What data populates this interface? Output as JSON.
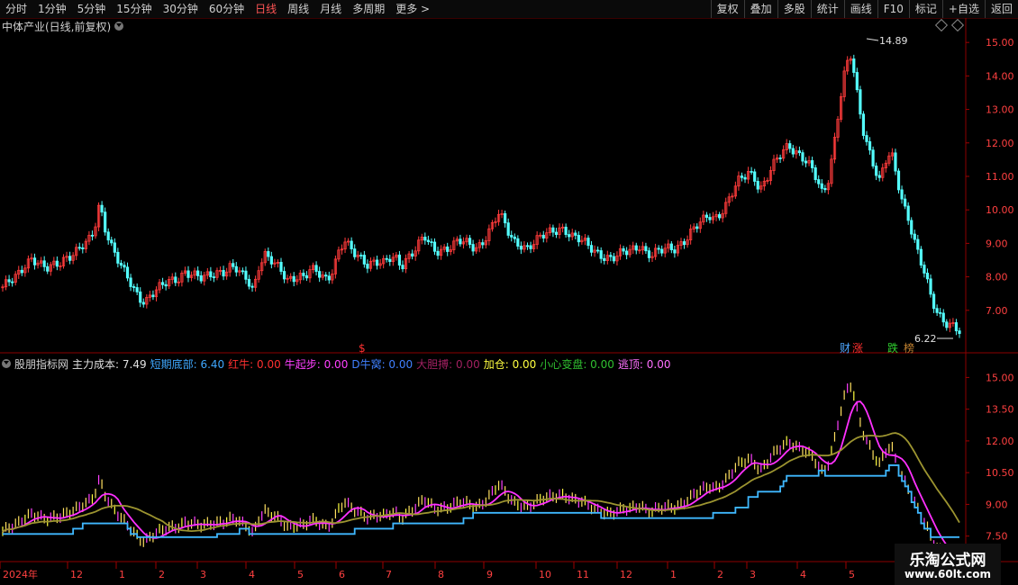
{
  "toolbar": {
    "periods": [
      "分时",
      "1分钟",
      "5分钟",
      "15分钟",
      "30分钟",
      "60分钟",
      "日线",
      "周线",
      "月线",
      "多周期",
      "更多 >"
    ],
    "active_period": "日线",
    "right_buttons": [
      "复权",
      "叠加",
      "多股",
      "统计",
      "画线",
      "F10",
      "标记",
      "+自选",
      "返回"
    ]
  },
  "main_title": "中体产业(日线,前复权)",
  "markers": {
    "high_label": "14.89",
    "low_label": "6.22",
    "dollar": "$",
    "badge_cai": "财",
    "badge_zhang": "涨",
    "badge_die": "跌",
    "badge_bang": "榜"
  },
  "indicator": {
    "name": "股朋指标网",
    "items": [
      {
        "label": "主力成本:",
        "value": "7.49",
        "color": "#e0e0e0"
      },
      {
        "label": "短期底部:",
        "value": "6.40",
        "color": "#3fa8ff"
      },
      {
        "label": "红牛:",
        "value": "0.00",
        "color": "#ff3030"
      },
      {
        "label": "牛起步:",
        "value": "0.00",
        "color": "#ff40ff"
      },
      {
        "label": "D牛窝:",
        "value": "0.00",
        "color": "#4080ff"
      },
      {
        "label": "大胆搏:",
        "value": "0.00",
        "color": "#a02060"
      },
      {
        "label": "加仓:",
        "value": "0.00",
        "color": "#ffff40"
      },
      {
        "label": "小心变盘:",
        "value": "0.00",
        "color": "#30c030"
      },
      {
        "label": "逃顶:",
        "value": "0.00",
        "color": "#ff70ff"
      }
    ]
  },
  "axis": {
    "main_ticks": [
      "15.00",
      "14.00",
      "13.00",
      "12.00",
      "11.00",
      "10.00",
      "9.00",
      "8.00",
      "7.00"
    ],
    "sub_ticks": [
      "15.00",
      "13.50",
      "12.00",
      "10.50",
      "9.00",
      "7.50"
    ],
    "x_labels": [
      "2024年",
      "12",
      "1",
      "2",
      "3",
      "4",
      "5",
      "6",
      "7",
      "8",
      "9",
      "10",
      "11",
      "12",
      "1",
      "2",
      "3",
      "4",
      "5"
    ]
  },
  "watermark": {
    "name": "乐淘公式网",
    "url": "www.60lt.com"
  },
  "chart_data": {
    "type": "candlestick",
    "main": {
      "ylim": [
        6.0,
        15.3
      ],
      "closes": [
        7.7,
        7.8,
        7.9,
        8.1,
        8.4,
        8.6,
        8.5,
        8.3,
        8.2,
        8.3,
        8.4,
        8.6,
        8.7,
        8.8,
        8.9,
        9.0,
        9.3,
        10.2,
        9.5,
        9.0,
        8.6,
        8.2,
        7.9,
        7.6,
        7.4,
        7.3,
        7.5,
        7.6,
        7.7,
        7.8,
        7.9,
        8.0,
        8.2,
        8.1,
        8.0,
        7.9,
        8.0,
        8.1,
        8.2,
        8.2,
        8.3,
        8.2,
        8.0,
        7.9,
        7.6,
        8.4,
        8.7,
        8.5,
        8.3,
        8.1,
        7.9,
        8.0,
        8.1,
        8.0,
        8.2,
        8.1,
        8.0,
        7.9,
        8.3,
        8.8,
        9.1,
        8.8,
        8.6,
        8.5,
        8.4,
        8.5,
        8.5,
        8.4,
        8.5,
        8.5,
        8.3,
        8.6,
        8.8,
        9.0,
        9.2,
        8.9,
        8.7,
        8.8,
        8.9,
        9.0,
        9.1,
        9.0,
        8.9,
        8.8,
        9.0,
        9.3,
        9.6,
        9.9,
        9.6,
        9.2,
        9.0,
        9.0,
        8.9,
        9.0,
        9.1,
        9.2,
        9.3,
        9.4,
        9.5,
        9.4,
        9.2,
        9.1,
        9.0,
        8.9,
        8.8,
        8.7,
        8.6,
        8.5,
        8.6,
        8.7,
        8.8,
        8.9,
        9.0,
        8.7,
        8.6,
        8.7,
        8.8,
        8.9,
        8.9,
        9.0,
        9.1,
        9.3,
        9.5,
        9.7,
        9.9,
        9.8,
        9.9,
        10.1,
        10.4,
        10.8,
        11.0,
        11.2,
        11.0,
        10.6,
        10.8,
        11.2,
        11.5,
        11.8,
        12.0,
        11.8,
        11.6,
        11.4,
        11.2,
        10.9,
        10.5,
        11.0,
        12.0,
        13.2,
        14.2,
        14.6,
        13.5,
        12.5,
        11.9,
        11.3,
        10.8,
        11.4,
        11.7,
        11.0,
        10.3,
        9.8,
        9.1,
        8.5,
        8.0,
        7.4,
        7.0,
        6.8,
        6.6,
        6.5,
        6.3
      ]
    },
    "sub": {
      "ylim": [
        7.4,
        15.4
      ],
      "series": [
        {
          "name": "主力成本",
          "color": "#e0e0e0"
        },
        {
          "name": "短期底部",
          "color": "#3fa8ff"
        }
      ]
    }
  }
}
